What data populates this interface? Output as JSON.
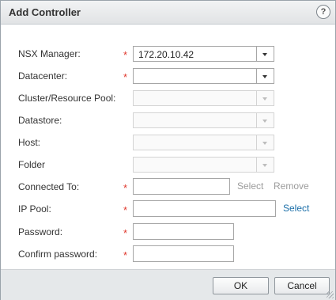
{
  "dialog": {
    "title": "Add Controller",
    "help_icon": "help-icon",
    "help_glyph": "?"
  },
  "form": {
    "required_marker": "*",
    "nsx_manager": {
      "label": "NSX Manager:",
      "value": "172.20.10.42",
      "required": true
    },
    "datacenter": {
      "label": "Datacenter:",
      "value": "",
      "required": true
    },
    "cluster_resource_pool": {
      "label": "Cluster/Resource Pool:",
      "value": "",
      "enabled": false
    },
    "datastore": {
      "label": "Datastore:",
      "value": "",
      "enabled": false
    },
    "host": {
      "label": "Host:",
      "value": "",
      "enabled": false
    },
    "folder": {
      "label": "Folder",
      "value": "",
      "enabled": false
    },
    "connected_to": {
      "label": "Connected To:",
      "value": "",
      "required": true,
      "select_label": "Select",
      "remove_label": "Remove"
    },
    "ip_pool": {
      "label": "IP Pool:",
      "value": "",
      "required": true,
      "select_label": "Select"
    },
    "password": {
      "label": "Password:",
      "value": "",
      "required": true
    },
    "confirm_password": {
      "label": "Confirm password:",
      "value": "",
      "required": true
    }
  },
  "footer": {
    "ok_label": "OK",
    "cancel_label": "Cancel"
  },
  "colors": {
    "required": "#e0372c",
    "link": "#1a6ea8",
    "link_disabled": "#9b9b9b",
    "footer_bg": "#e5e8ea"
  }
}
